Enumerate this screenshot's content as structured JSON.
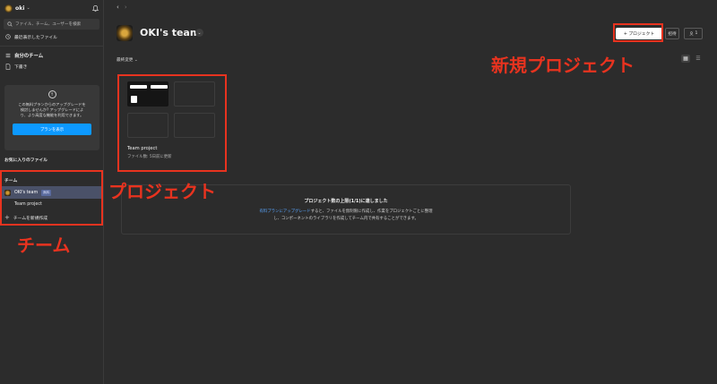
{
  "sidebar": {
    "username": "oki",
    "search_placeholder": "ファイル、チーム、ユーザーを検索",
    "recent": "最近表示したファイル",
    "my_team": "自分のチーム",
    "drafts": "下書き",
    "upgrade": {
      "line1": "この無料プランからのアップグレードを",
      "line2": "検討しませんか? アップグレードによ",
      "line3": "り、より高度な機能を利用できます。",
      "button": "プランを表示"
    },
    "favorites": "お気に入りのファイル",
    "teams_header": "チーム",
    "team_name": "OKI's team",
    "team_badge": "無料",
    "team_project": "Team project",
    "new_team": "チームを新規作成"
  },
  "main": {
    "title": "OKI's team",
    "new_project": "+ プロジェクト",
    "invite": "招待",
    "member_count": "1",
    "sort_label": "最終変更 ⌄",
    "card": {
      "name": "Team project",
      "meta": "ファイル数: 5日前に更新"
    },
    "limit": {
      "title": "プロジェクト数の上限(1/1)に達しました",
      "link": "有料プランにアップグレード",
      "rest1": "すると、ファイルを無制限に作成し、作業をプロジェクトごとに整理",
      "line2": "し、コンポーネントのライブラリを作成してチーム内で共有することができます。"
    }
  },
  "annotations": {
    "new_project": "新規プロジェクト",
    "project": "プロジェクト",
    "team": "チーム",
    "color": "#e8331f"
  }
}
